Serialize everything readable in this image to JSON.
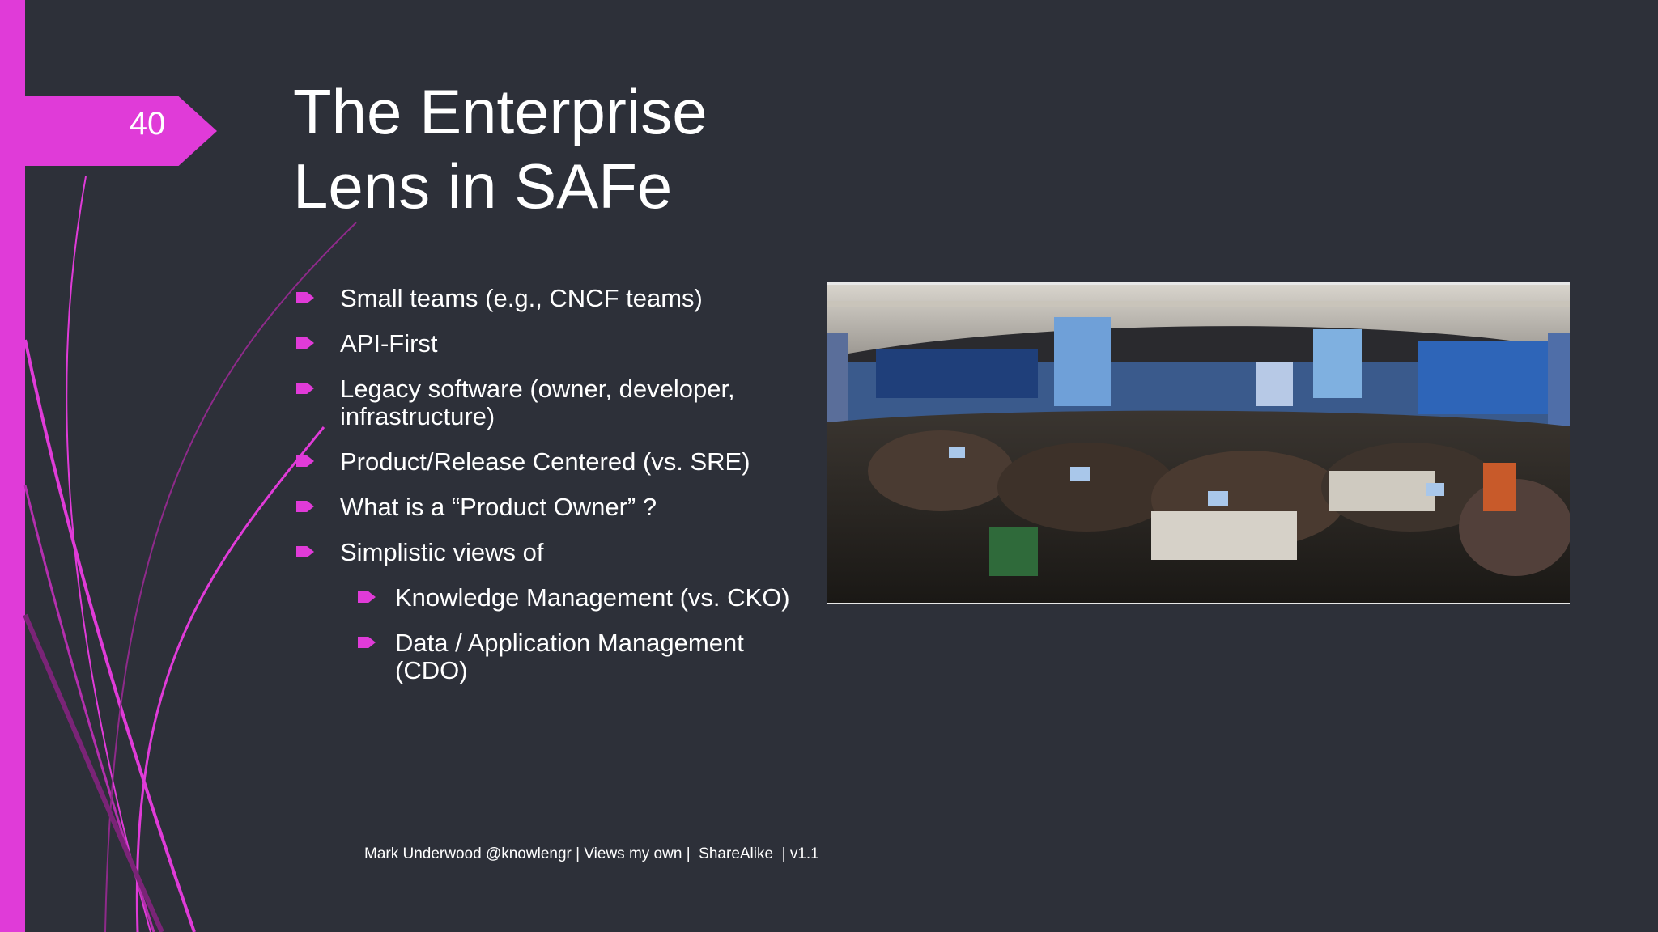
{
  "slide": {
    "number": "40",
    "title_line1": "The Enterprise",
    "title_line2": "Lens in SAFe",
    "bullets": [
      {
        "text": "Small teams (e.g., CNCF teams)"
      },
      {
        "text": "API-First"
      },
      {
        "text": "Legacy software (owner, developer, infrastructure)"
      },
      {
        "text": "Product/Release Centered (vs. SRE)"
      },
      {
        "text": "What is a “Product Owner” ?"
      },
      {
        "text": "Simplistic views of"
      }
    ],
    "sub_bullets": [
      {
        "text": "Knowledge Management (vs. CKO)"
      },
      {
        "text": "Data / Application Management (CDO)"
      }
    ],
    "footer": "Mark Underwood @knowlengr | Views my own |  ShareAlike  | v1.1"
  },
  "colors": {
    "background": "#2d3039",
    "accent": "#e03bd8",
    "text": "#ffffff"
  },
  "icons": {
    "bullet": "arrow-bullet-icon"
  }
}
